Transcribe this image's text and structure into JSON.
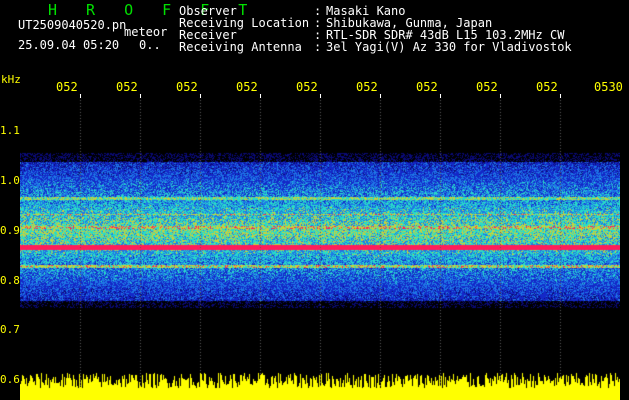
{
  "header": {
    "title": "H R O F F T",
    "filename": "UT2509040520.pn",
    "meteor_tag": "meteor",
    "datetime": "25.09.04 05:20",
    "count": "0..",
    "fields": [
      {
        "label": "Observer",
        "sep": ":",
        "value": "Masaki Kano"
      },
      {
        "label": "Receiving Location",
        "sep": ":",
        "value": "Shibukawa, Gunma, Japan"
      },
      {
        "label": "Receiver",
        "sep": ":",
        "value": "RTL-SDR SDR# 43dB L15 103.2MHz CW"
      },
      {
        "label": "Receiving Antenna",
        "sep": ":",
        "value": "3el Yagi(V) Az 330 for Vladivostok"
      }
    ]
  },
  "axes": {
    "unit": "kHz",
    "x_ticks": [
      "052",
      "052",
      "052",
      "052",
      "052",
      "052",
      "052",
      "052",
      "052",
      "0530"
    ],
    "y_ticks": [
      "1.1",
      "1.0",
      "0.9",
      "0.8",
      "0.7",
      "0.6"
    ]
  },
  "colors": {
    "title": "#00e000",
    "axis_text": "#ffff00",
    "background": "#000000",
    "echo_line": "#ff2050",
    "amplitude": "#ffff00"
  }
}
